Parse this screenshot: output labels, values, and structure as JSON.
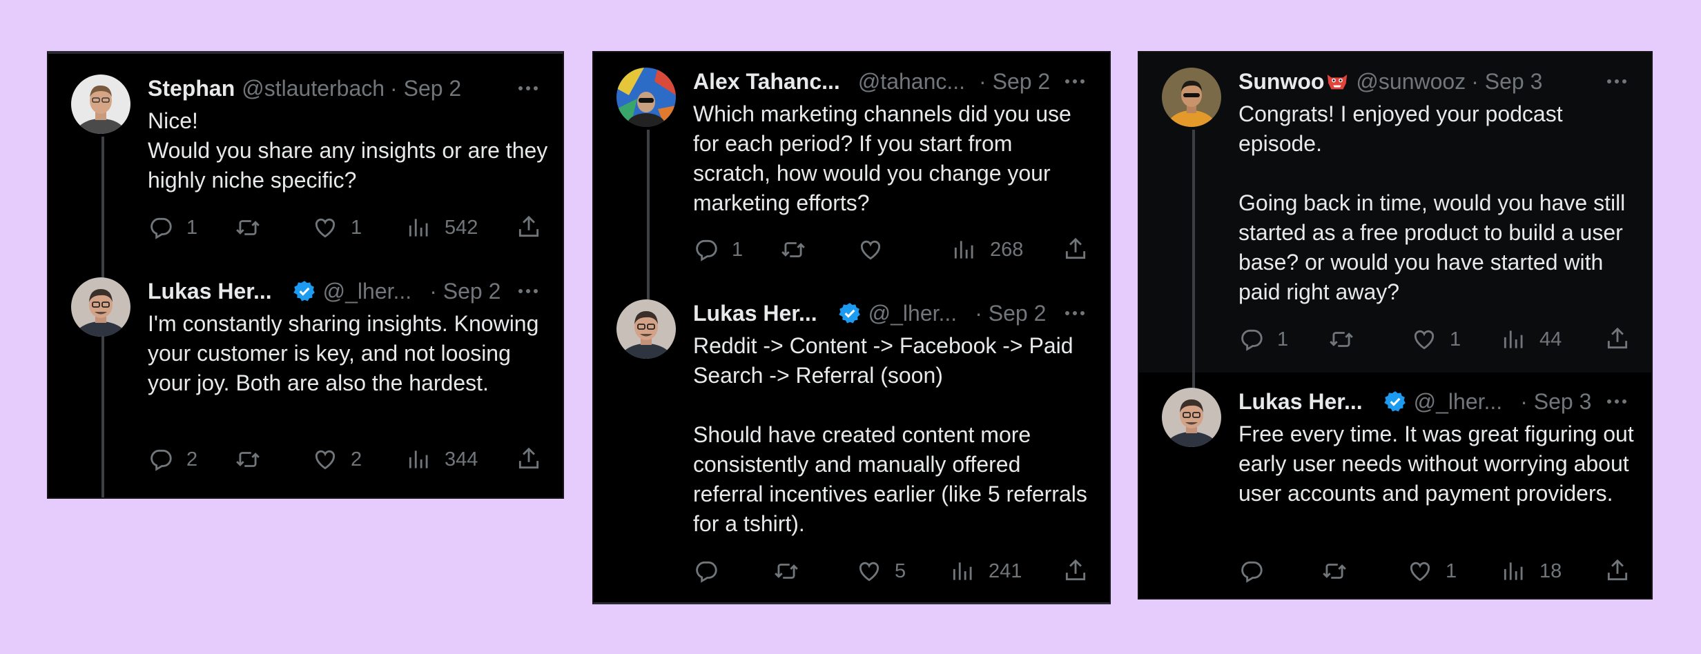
{
  "colors": {
    "background": "#e6ccfd",
    "card": "#000000",
    "text": "#e7e9ea",
    "muted": "#71767b",
    "verified": "#1d9bf0"
  },
  "cards": [
    {
      "tweets": [
        {
          "name": "Stephan",
          "handle": "@stlauterbach",
          "date": "· Sep 2",
          "verified": false,
          "text": "Nice!\nWould you share any insights or are they highly niche specific?",
          "replies": "1",
          "retweets": "",
          "likes": "1",
          "views": "542"
        },
        {
          "name": "Lukas Her...",
          "handle": "@_lher...",
          "date": "· Sep 2",
          "verified": true,
          "text": "I'm constantly sharing insights. Knowing your customer is key, and not loosing your joy. Both are also the hardest.",
          "replies": "2",
          "retweets": "",
          "likes": "2",
          "views": "344"
        }
      ]
    },
    {
      "tweets": [
        {
          "name": "Alex Tahanc...",
          "handle": "@tahanc...",
          "date": "· Sep 2",
          "verified": false,
          "text": "Which marketing channels did you use for each period? If you start from scratch, how would you change your marketing efforts?",
          "replies": "1",
          "retweets": "",
          "likes": "",
          "views": "268"
        },
        {
          "name": "Lukas Her...",
          "handle": "@_lher...",
          "date": "· Sep 2",
          "verified": true,
          "text": "Reddit -> Content -> Facebook -> Paid Search -> Referral (soon)\n\nShould have created content more consistently and manually offered referral incentives earlier (like 5 referrals for a tshirt).",
          "replies": "",
          "retweets": "",
          "likes": "5",
          "views": "241"
        }
      ]
    },
    {
      "tweets": [
        {
          "name": "Sunwoo",
          "handle": "@sunwooz",
          "date": "· Sep 3",
          "verified": false,
          "emoji": "goblin-mask-emoji",
          "text": "Congrats! I enjoyed your podcast episode.\n\nGoing back in time, would you have still started as a free product to build a user base? or would you have started with paid right away?",
          "replies": "1",
          "retweets": "",
          "likes": "1",
          "views": "44"
        },
        {
          "name": "Lukas Her...",
          "handle": "@_lher...",
          "date": "· Sep 3",
          "verified": true,
          "text": "Free every time. It was great figuring out early user needs without worrying about user accounts and payment providers.",
          "replies": "",
          "retweets": "",
          "likes": "1",
          "views": "18"
        }
      ]
    }
  ]
}
